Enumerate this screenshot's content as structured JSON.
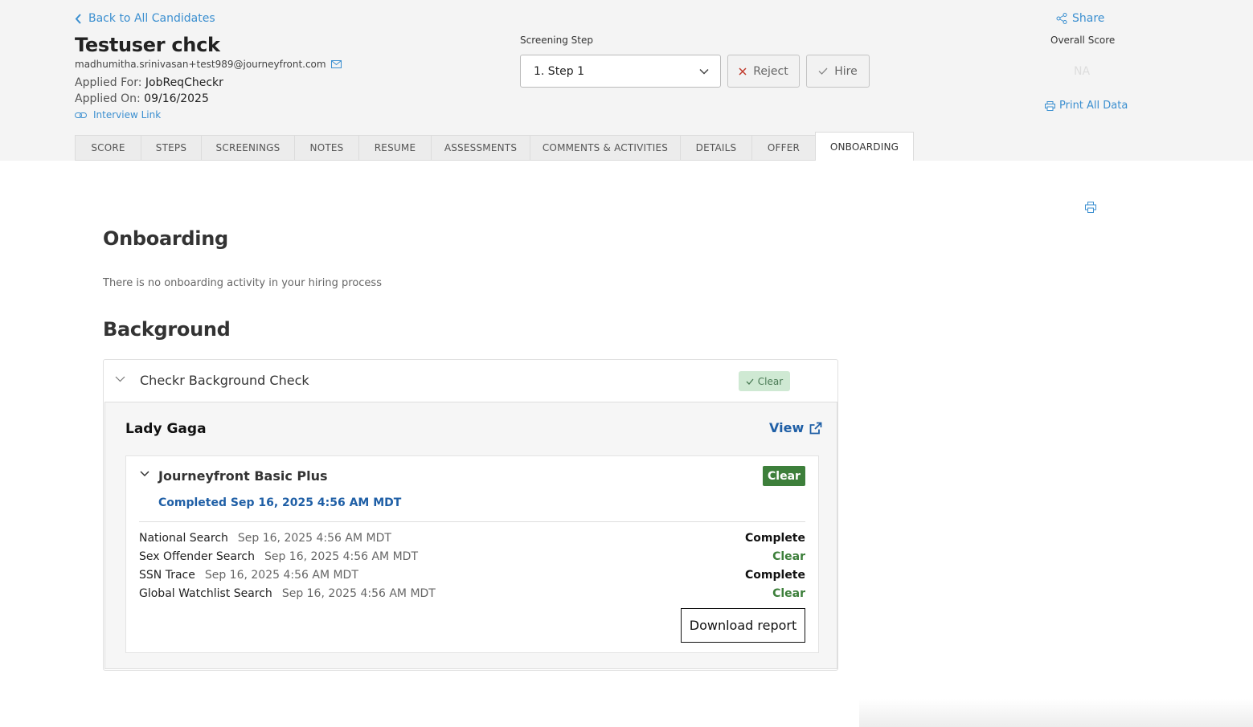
{
  "header": {
    "back_label": "Back to All Candidates",
    "candidate_name": "Testuser chck",
    "email": "madhumitha.srinivasan+test989@journeyfront.com",
    "applied_for_label": "Applied For:",
    "applied_for_value": "JobReqCheckr",
    "applied_on_label": "Applied On:",
    "applied_on_value": "09/16/2025",
    "interview_link_label": "Interview Link",
    "screening_step_label": "Screening Step",
    "screening_step_value": "1. Step 1",
    "reject_label": "Reject",
    "hire_label": "Hire",
    "share_label": "Share",
    "overall_score_label": "Overall Score",
    "overall_score_value": "NA",
    "print_all_label": "Print All Data"
  },
  "tabs": [
    {
      "label": "SCORE",
      "active": false
    },
    {
      "label": "STEPS",
      "active": false
    },
    {
      "label": "SCREENINGS",
      "active": false
    },
    {
      "label": "NOTES",
      "active": false
    },
    {
      "label": "RESUME",
      "active": false
    },
    {
      "label": "ASSESSMENTS",
      "active": false
    },
    {
      "label": "COMMENTS & ACTIVITIES",
      "active": false
    },
    {
      "label": "DETAILS",
      "active": false
    },
    {
      "label": "OFFER",
      "active": false
    },
    {
      "label": "ONBOARDING",
      "active": true
    }
  ],
  "onboarding": {
    "title": "Onboarding",
    "empty_message": "There is no onboarding activity in your hiring process"
  },
  "background": {
    "title": "Background",
    "check_title": "Checkr Background Check",
    "check_status": "Clear",
    "person_name": "Lady Gaga",
    "view_label": "View",
    "package_name": "Journeyfront Basic Plus",
    "package_status": "Clear",
    "completed_text": "Completed Sep 16, 2025 4:56 AM MDT",
    "searches": [
      {
        "name": "National Search",
        "date": "Sep 16, 2025 4:56 AM MDT",
        "status": "Complete"
      },
      {
        "name": "Sex Offender Search",
        "date": "Sep 16, 2025 4:56 AM MDT",
        "status": "Clear"
      },
      {
        "name": "SSN Trace",
        "date": "Sep 16, 2025 4:56 AM MDT",
        "status": "Complete"
      },
      {
        "name": "Global Watchlist Search",
        "date": "Sep 16, 2025 4:56 AM MDT",
        "status": "Clear"
      }
    ],
    "download_label": "Download report"
  },
  "colors": {
    "link": "#3b8fd0",
    "primary_blue": "#1f5fa6",
    "clear_green": "#3d7f3b",
    "header_bg": "#f4f4f4"
  },
  "icons": [
    "chevron-left-icon",
    "envelope-icon",
    "link-icon",
    "chevron-down-icon",
    "x-icon",
    "check-icon",
    "share-icon",
    "printer-icon",
    "external-link-icon"
  ]
}
